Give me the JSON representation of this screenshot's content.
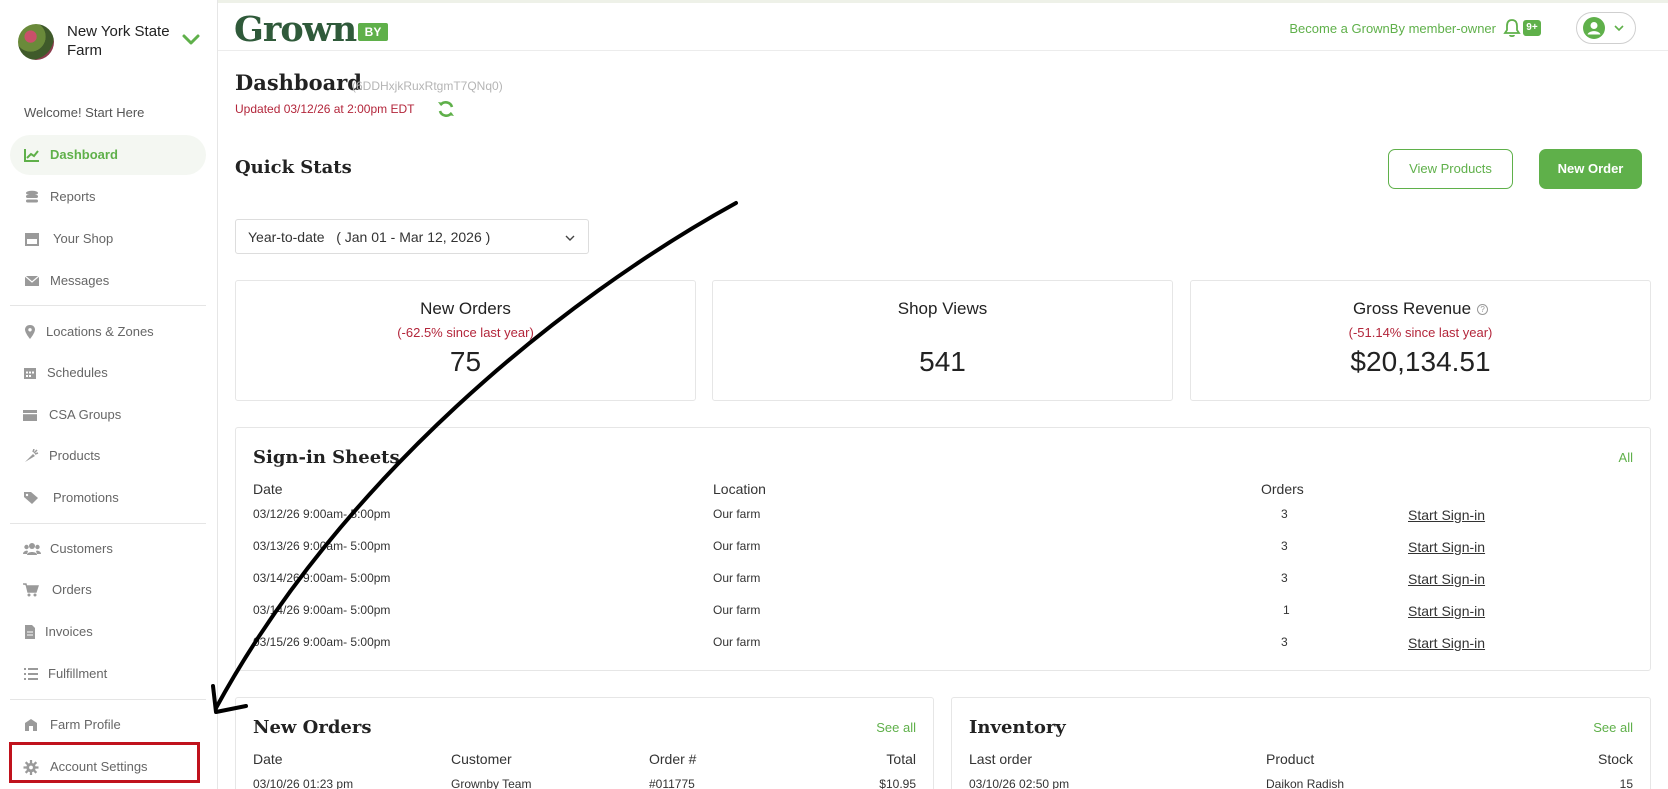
{
  "sidebar": {
    "farm_name": "New York State Farm",
    "welcome": "Welcome! Start Here",
    "items": [
      {
        "label": "Dashboard",
        "icon": "chart-line-icon"
      },
      {
        "label": "Reports",
        "icon": "coins-icon"
      },
      {
        "label": "Your Shop",
        "icon": "store-icon"
      },
      {
        "label": "Messages",
        "icon": "envelope-icon"
      },
      {
        "label": "Locations & Zones",
        "icon": "map-pin-icon"
      },
      {
        "label": "Schedules",
        "icon": "calendar-icon"
      },
      {
        "label": "CSA Groups",
        "icon": "box-icon"
      },
      {
        "label": "Products",
        "icon": "carrot-icon"
      },
      {
        "label": "Promotions",
        "icon": "tags-icon"
      },
      {
        "label": "Customers",
        "icon": "users-icon"
      },
      {
        "label": "Orders",
        "icon": "cart-icon"
      },
      {
        "label": "Invoices",
        "icon": "document-icon"
      },
      {
        "label": "Fulfillment",
        "icon": "list-icon"
      },
      {
        "label": "Farm Profile",
        "icon": "farm-icon"
      },
      {
        "label": "Account Settings",
        "icon": "gear-icon"
      }
    ]
  },
  "header": {
    "logo_text": "Grown",
    "logo_by": "BY",
    "member_link": "Become a GrownBy member-owner",
    "notification_badge": "9+"
  },
  "dashboard": {
    "title": "Dashboard",
    "id": "(6DDHxjkRuxRtgmT7QNq0)",
    "updated": "Updated 03/12/26 at 2:00pm EDT"
  },
  "quick_stats": {
    "title": "Quick Stats",
    "view_products": "View Products",
    "new_order": "New Order",
    "range": "Year-to-date   ( Jan 01 - Mar 12, 2026 )",
    "stats": [
      {
        "label": "New Orders",
        "change": "(-62.5% since last year)",
        "value": "75"
      },
      {
        "label": "Shop Views",
        "change": "",
        "value": "541"
      },
      {
        "label": "Gross Revenue",
        "change": "(-51.14% since last year)",
        "value": "$20,134.51"
      }
    ]
  },
  "signin": {
    "title": "Sign-in Sheets",
    "all_link": "All",
    "headers": {
      "date": "Date",
      "location": "Location",
      "orders": "Orders"
    },
    "action": "Start Sign-in",
    "rows": [
      {
        "date": "03/12/26  9:00am- 5:00pm",
        "location": "Our farm",
        "orders": "3"
      },
      {
        "date": "03/13/26  9:00am- 5:00pm",
        "location": "Our farm",
        "orders": "3"
      },
      {
        "date": "03/14/26  9:00am- 5:00pm",
        "location": "Our farm",
        "orders": "3"
      },
      {
        "date": "03/14/26  9:00am- 5:00pm",
        "location": "Our farm",
        "orders": "1"
      },
      {
        "date": "03/15/26  9:00am- 5:00pm",
        "location": "Our farm",
        "orders": "3"
      }
    ]
  },
  "new_orders": {
    "title": "New Orders",
    "see_all": "See all",
    "headers": {
      "date": "Date",
      "customer": "Customer",
      "order": "Order #",
      "total": "Total"
    },
    "rows": [
      {
        "date": "03/10/26 01:23 pm",
        "customer": "Grownby Team",
        "order": "#011775",
        "total": "$10.95"
      }
    ]
  },
  "inventory": {
    "title": "Inventory",
    "see_all": "See all",
    "headers": {
      "last_order": "Last order",
      "product": "Product",
      "stock": "Stock"
    },
    "rows": [
      {
        "last_order": "03/10/26 02:50 pm",
        "product": "Daikon Radish",
        "stock": "15"
      }
    ]
  },
  "colors": {
    "accent_green": "#5fb04a",
    "negative_red": "#b3263b",
    "highlight_box": "#c0121c",
    "logo_green": "#2f5a3a"
  }
}
